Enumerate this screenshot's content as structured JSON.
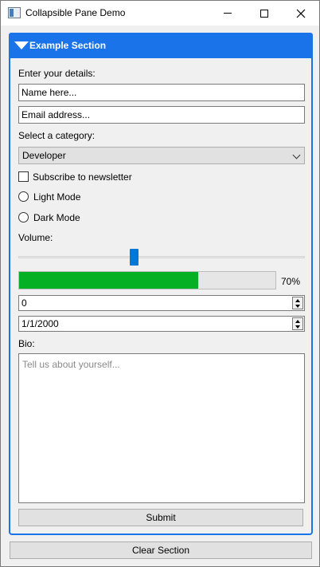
{
  "window": {
    "title": "Collapsible Pane Demo",
    "icon": "app-window-icon"
  },
  "pane": {
    "header_title": "Example Section",
    "expanded": true,
    "accent_color": "#1a73e8",
    "details_label": "Enter your details:",
    "name_placeholder": "Name here...",
    "email_placeholder": "Email address...",
    "category_label": "Select a category:",
    "category_selected": "Developer",
    "subscribe_label": "Subscribe to newsletter",
    "subscribe_checked": false,
    "radio_light_label": "Light Mode",
    "radio_dark_label": "Dark Mode",
    "volume_label": "Volume:",
    "volume_fraction": 0.4,
    "progress_percent": 70,
    "progress_text": "70%",
    "progress_color": "#06b025",
    "spin_value": "0",
    "date_value": "1/1/2000",
    "bio_label": "Bio:",
    "bio_placeholder": "Tell us about yourself...",
    "submit_label": "Submit"
  },
  "footer": {
    "clear_label": "Clear Section"
  }
}
